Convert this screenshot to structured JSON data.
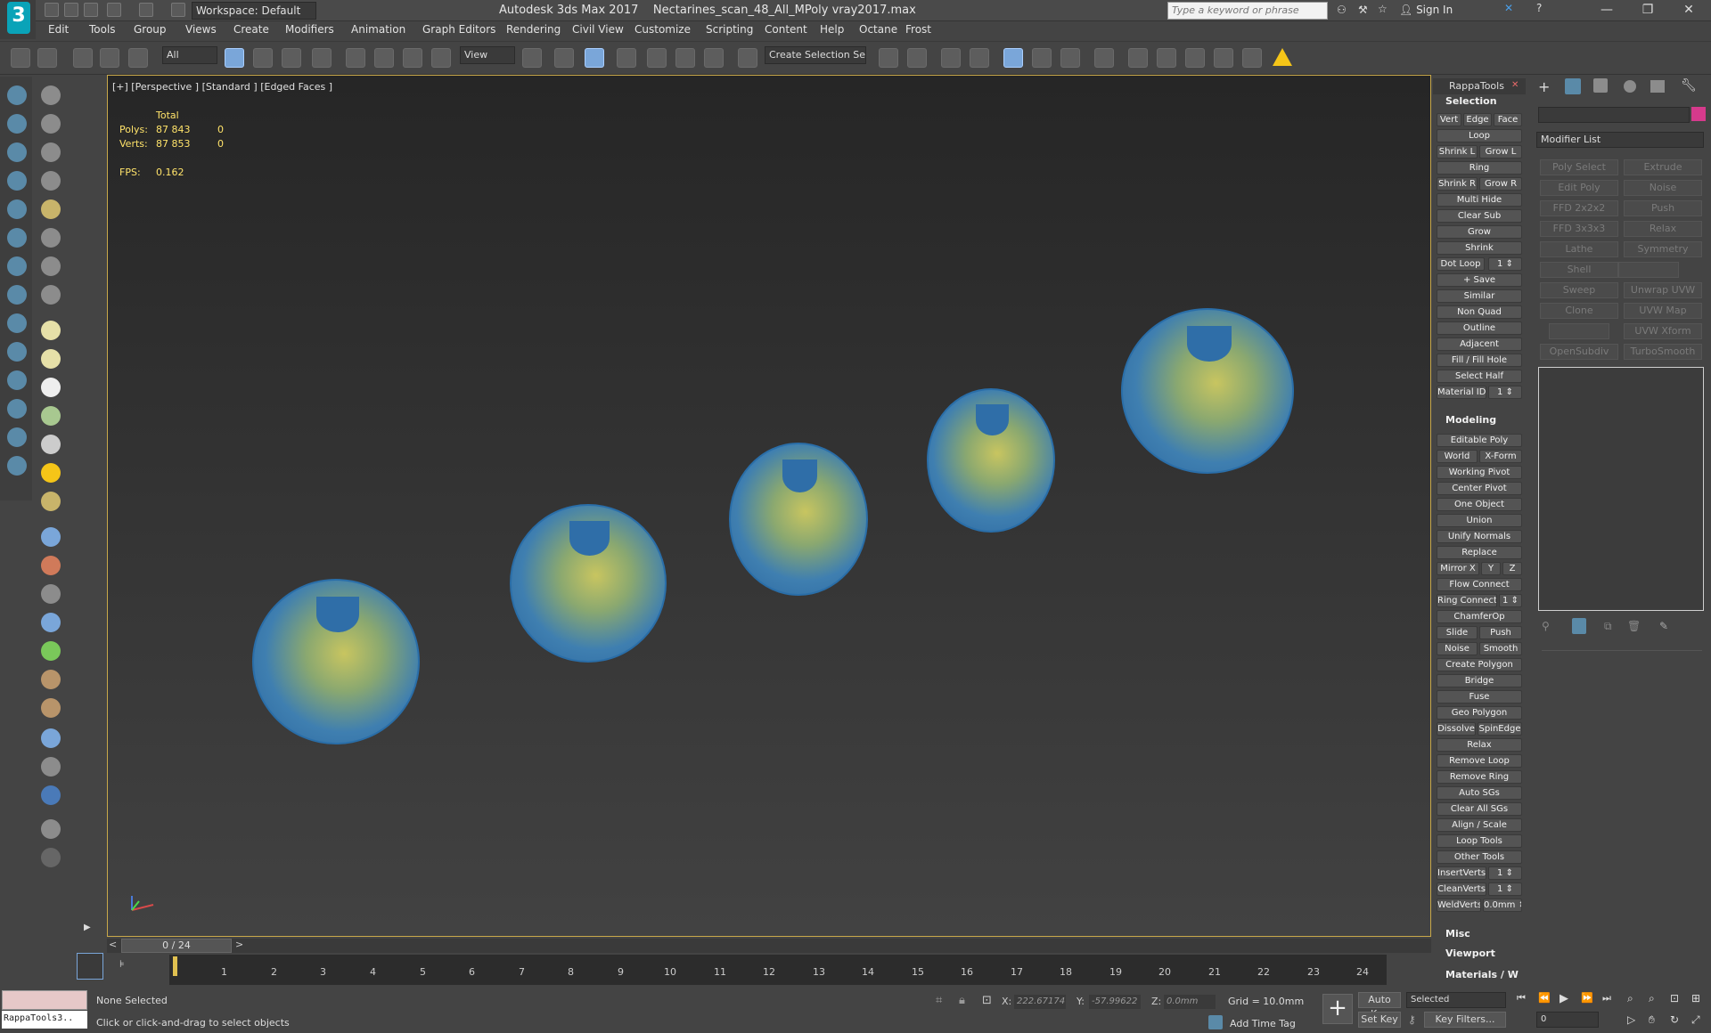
{
  "app": {
    "title": "Autodesk 3ds Max 2017",
    "file": "Nectarines_scan_48_All_MPoly vray2017.max",
    "workspace": "Workspace: Default",
    "search_placeholder": "Type a keyword or phrase",
    "signin": "Sign In"
  },
  "menu": [
    "Edit",
    "Tools",
    "Group",
    "Views",
    "Create",
    "Modifiers",
    "Animation",
    "Graph Editors",
    "Rendering",
    "Civil View",
    "Customize",
    "Scripting",
    "Content",
    "Help",
    "Octane",
    "Frost"
  ],
  "toolbar": {
    "filter": "All",
    "refcoord": "View",
    "selset": "Create Selection Se"
  },
  "viewport": {
    "label": "[+] [Perspective ] [Standard ] [Edged Faces ]",
    "stats": {
      "header": "Total",
      "polys_label": "Polys:",
      "polys_total": "87 843",
      "polys_sel": "0",
      "verts_label": "Verts:",
      "verts_total": "87 853",
      "verts_sel": "0",
      "fps_label": "FPS:",
      "fps": "0.162"
    }
  },
  "timeline": {
    "slider": "0 / 24",
    "ticks": [
      "1",
      "2",
      "3",
      "4",
      "5",
      "6",
      "7",
      "8",
      "9",
      "10",
      "11",
      "12",
      "13",
      "14",
      "15",
      "16",
      "17",
      "18",
      "19",
      "20",
      "21",
      "22",
      "23",
      "24"
    ]
  },
  "status": {
    "maxscript": "RappaTools3..",
    "selection": "None Selected",
    "prompt": "Click or click-and-drag to select objects",
    "x_label": "X:",
    "x_value": "222.67174",
    "y_label": "Y:",
    "y_value": "-57.99622",
    "z_label": "Z:",
    "z_value": "0.0mm",
    "grid": "Grid = 10.0mm",
    "add_time_tag": "Add Time Tag",
    "auto_key": "Auto Key",
    "selected": "Selected",
    "set_key": "Set Key",
    "key_filters": "Key Filters...",
    "frame": "0"
  },
  "rappa": {
    "title": "RappaTools",
    "selection_header": "Selection",
    "modeling_header": "Modeling",
    "misc_header": "Misc",
    "viewport_header": "Viewport",
    "materials_header": "Materials / W"
  },
  "cmd": {
    "modifier_list": "Modifier List",
    "buttons": [
      "Poly Select",
      "Extrude",
      "Edit Poly",
      "Noise",
      "FFD 2x2x2",
      "Push",
      "FFD 3x3x3",
      "Relax",
      "Lathe",
      "Symmetry",
      "Shell",
      "",
      "Sweep",
      "Unwrap UVW",
      "Clone",
      "UVW Map",
      "",
      "UVW Xform",
      "OpenSubdiv",
      "TurboSmooth"
    ]
  },
  "colors": {
    "accent": "#c8a84a",
    "fruit_blue": "#2a6ea8",
    "fruit_yellow": "#c8c560",
    "warning": "#f5c518"
  }
}
